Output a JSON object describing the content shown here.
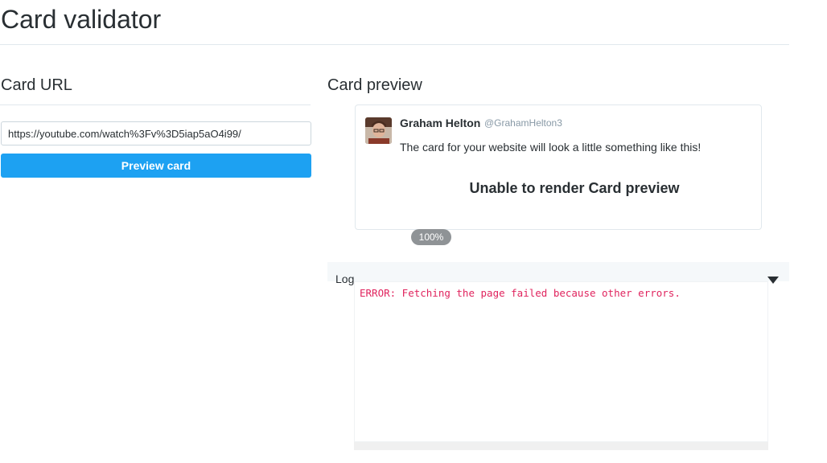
{
  "page": {
    "title": "Card validator"
  },
  "url_section": {
    "heading": "Card URL",
    "url_value": "https://youtube.com/watch%3Fv%3D5iap5aO4i99/",
    "preview_button_label": "Preview card"
  },
  "preview_section": {
    "heading": "Card preview",
    "card": {
      "user_name": "Graham Helton",
      "user_handle": "@GrahamHelton3",
      "tweet_text": "The card for your website will look a little something like this!",
      "render_message": "Unable to render Card preview"
    },
    "zoom_level": "100%"
  },
  "log_section": {
    "label": "Log",
    "toggle_icon": "triangle-down-icon",
    "entries": [
      {
        "text": "ERROR: Fetching the page failed because other errors.",
        "level": "error",
        "color": "#e0245e"
      }
    ]
  },
  "colors": {
    "accent": "#1da1f2",
    "error": "#e0245e",
    "text": "#292f33",
    "muted": "#8899a6"
  }
}
